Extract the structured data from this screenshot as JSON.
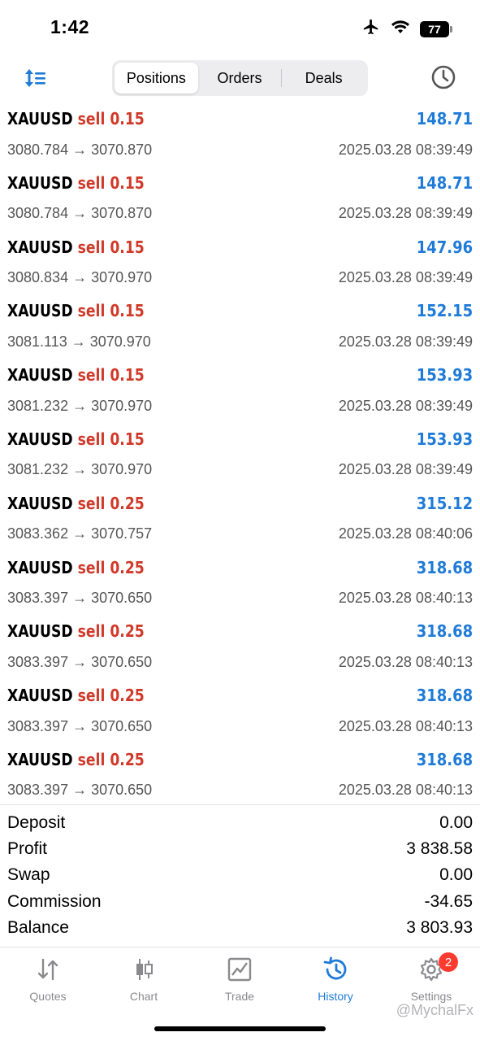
{
  "status": {
    "time": "1:42",
    "battery": "77"
  },
  "toolbar": {
    "tabs": [
      {
        "label": "Positions",
        "active": true
      },
      {
        "label": "Orders",
        "active": false
      },
      {
        "label": "Deals",
        "active": false
      }
    ],
    "sort_icon": "sort-icon",
    "history_icon": "clock-icon"
  },
  "deals": [
    {
      "symbol": "XAUUSD",
      "side": "sell",
      "volume": "0.15",
      "profit": "148.71",
      "prices": "3080.784 → 3070.870",
      "time": "2025.03.28 08:39:49"
    },
    {
      "symbol": "XAUUSD",
      "side": "sell",
      "volume": "0.15",
      "profit": "148.71",
      "prices": "3080.784 → 3070.870",
      "time": "2025.03.28 08:39:49"
    },
    {
      "symbol": "XAUUSD",
      "side": "sell",
      "volume": "0.15",
      "profit": "147.96",
      "prices": "3080.834 → 3070.970",
      "time": "2025.03.28 08:39:49"
    },
    {
      "symbol": "XAUUSD",
      "side": "sell",
      "volume": "0.15",
      "profit": "152.15",
      "prices": "3081.113 → 3070.970",
      "time": "2025.03.28 08:39:49"
    },
    {
      "symbol": "XAUUSD",
      "side": "sell",
      "volume": "0.15",
      "profit": "153.93",
      "prices": "3081.232 → 3070.970",
      "time": "2025.03.28 08:39:49"
    },
    {
      "symbol": "XAUUSD",
      "side": "sell",
      "volume": "0.15",
      "profit": "153.93",
      "prices": "3081.232 → 3070.970",
      "time": "2025.03.28 08:39:49"
    },
    {
      "symbol": "XAUUSD",
      "side": "sell",
      "volume": "0.25",
      "profit": "315.12",
      "prices": "3083.362 → 3070.757",
      "time": "2025.03.28 08:40:06"
    },
    {
      "symbol": "XAUUSD",
      "side": "sell",
      "volume": "0.25",
      "profit": "318.68",
      "prices": "3083.397 → 3070.650",
      "time": "2025.03.28 08:40:13"
    },
    {
      "symbol": "XAUUSD",
      "side": "sell",
      "volume": "0.25",
      "profit": "318.68",
      "prices": "3083.397 → 3070.650",
      "time": "2025.03.28 08:40:13"
    },
    {
      "symbol": "XAUUSD",
      "side": "sell",
      "volume": "0.25",
      "profit": "318.68",
      "prices": "3083.397 → 3070.650",
      "time": "2025.03.28 08:40:13"
    },
    {
      "symbol": "XAUUSD",
      "side": "sell",
      "volume": "0.25",
      "profit": "318.68",
      "prices": "3083.397 → 3070.650",
      "time": "2025.03.28 08:40:13"
    }
  ],
  "summary": [
    {
      "label": "Deposit",
      "value": "0.00"
    },
    {
      "label": "Profit",
      "value": "3 838.58"
    },
    {
      "label": "Swap",
      "value": "0.00"
    },
    {
      "label": "Commission",
      "value": "-34.65"
    },
    {
      "label": "Balance",
      "value": "3 803.93"
    }
  ],
  "tabbar": {
    "items": [
      {
        "label": "Quotes",
        "icon": "quotes-icon",
        "active": false
      },
      {
        "label": "Chart",
        "icon": "chart-icon",
        "active": false
      },
      {
        "label": "Trade",
        "icon": "trade-icon",
        "active": false
      },
      {
        "label": "History",
        "icon": "history-icon",
        "active": true
      },
      {
        "label": "Settings",
        "icon": "settings-icon",
        "active": false,
        "badge": "2"
      }
    ]
  },
  "watermark": "@MychalFx",
  "colors": {
    "accent": "#1f7bd8",
    "sell": "#d03a2a",
    "badge": "#ff3b30"
  }
}
